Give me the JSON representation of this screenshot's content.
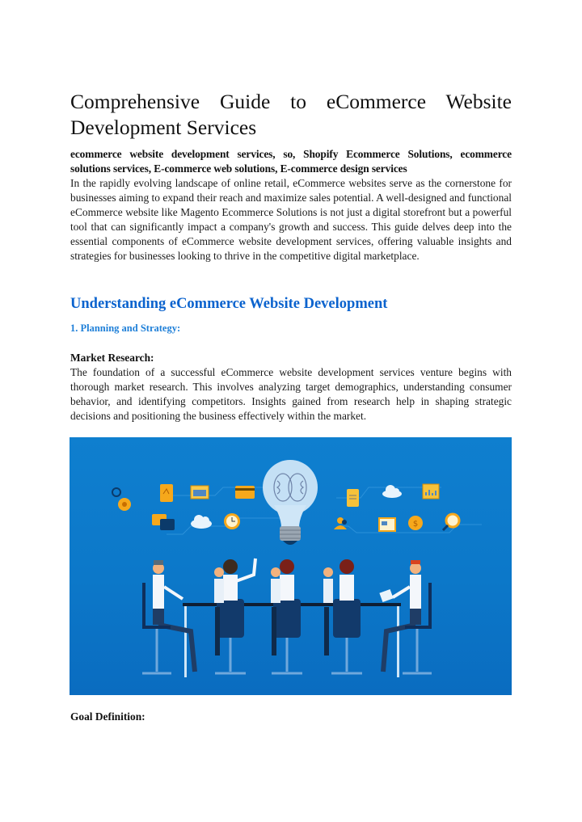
{
  "document": {
    "title_line1": "Comprehensive Guide to eCommerce Website",
    "title_line2": "Development Services",
    "keywords": "ecommerce website development services, so, Shopify Ecommerce Solutions, ecommerce solutions services, E-commerce web solutions, E-commerce design services",
    "intro": "In the rapidly evolving landscape of online retail, eCommerce websites serve as the cornerstone for businesses aiming to expand their reach and maximize sales potential. A well-designed and functional eCommerce website like Magento Ecommerce Solutions is not just a digital storefront but a powerful tool that can significantly impact a company's growth and success. This guide delves deep into the essential components of eCommerce website development services, offering valuable insights and strategies for businesses looking to thrive in the competitive digital marketplace.",
    "section_heading": "Understanding eCommerce Website Development",
    "subsection_heading": "1. Planning and Strategy:",
    "market_research": {
      "heading": "Market Research:",
      "body": "The foundation of a successful eCommerce website development services venture begins with thorough market research. This involves analyzing target demographics, understanding consumer behavior, and identifying competitors. Insights gained from research help in shaping strategic decisions and positioning the business effectively within the market."
    },
    "figure": {
      "description": "Illustration of a business team meeting around a table under a light bulb with a brain, surrounded by business icons",
      "icons": [
        "gear-icon",
        "document-icon",
        "browser-window-icon",
        "credit-card-icon",
        "chat-icon",
        "cloud-icon",
        "clock-icon",
        "lightbulb-brain-icon",
        "file-icon",
        "cloud-icon",
        "chart-icon",
        "users-icon",
        "newspaper-icon",
        "dollar-coin-icon",
        "magnifier-icon"
      ]
    },
    "goal_definition": {
      "heading": "Goal Definition:"
    }
  },
  "colors": {
    "heading_blue": "#0b63ce",
    "subheading_blue": "#1e7fd8",
    "figure_background": "#0c78c9"
  }
}
